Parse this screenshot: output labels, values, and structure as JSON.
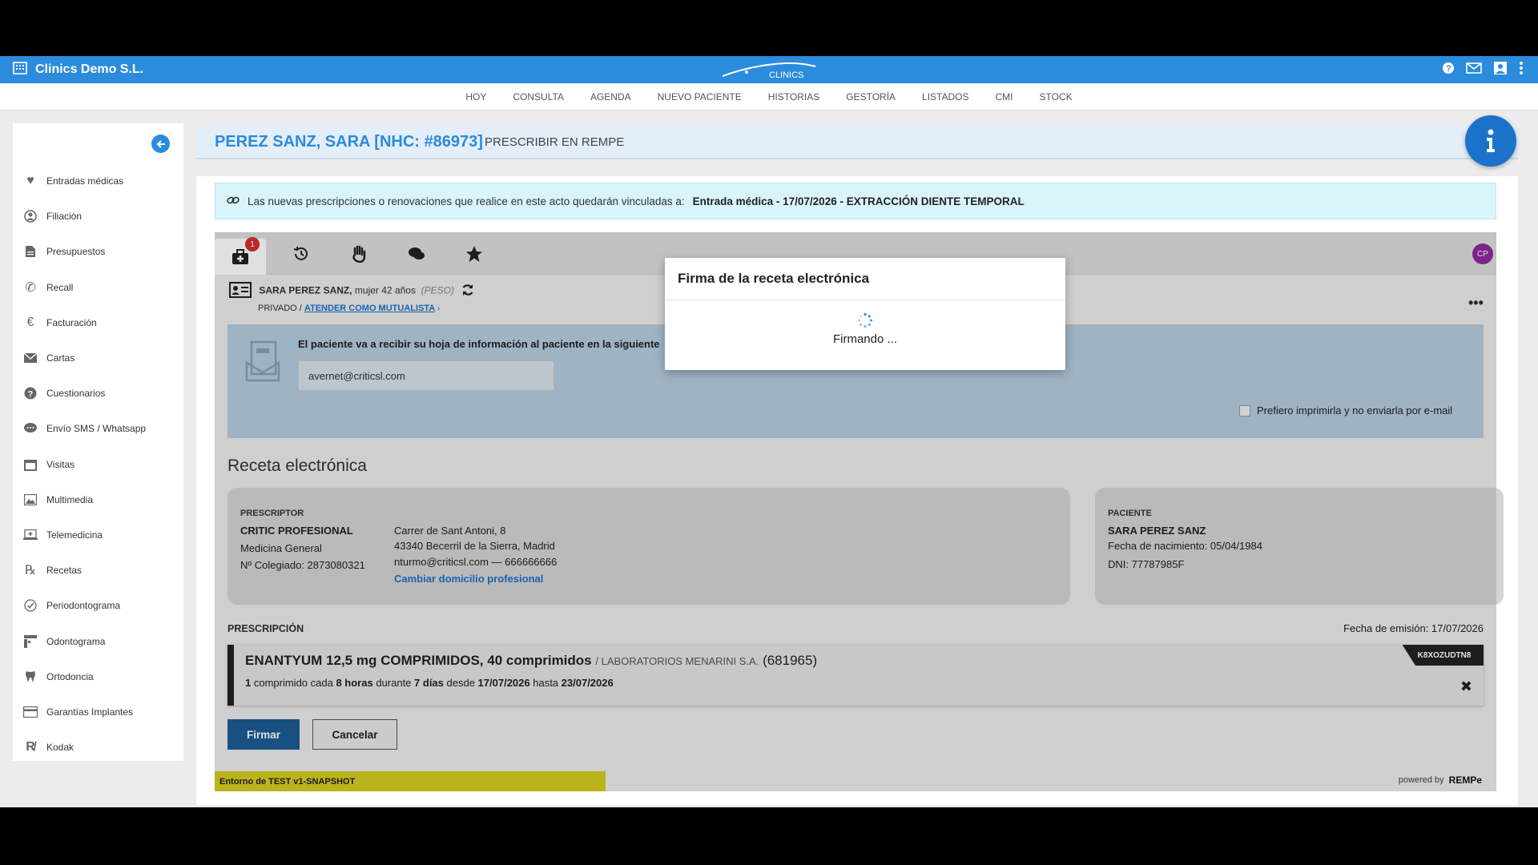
{
  "app": {
    "company": "Clinics Demo S.L.",
    "logo_text": "CLINICS"
  },
  "nav": [
    "HOY",
    "CONSULTA",
    "AGENDA",
    "NUEVO PACIENTE",
    "HISTORIAS",
    "GESTORÍA",
    "LISTADOS",
    "CMI",
    "STOCK"
  ],
  "sidebar": {
    "items": [
      {
        "label": "Entradas médicas",
        "icon": "heartbeat-icon"
      },
      {
        "label": "Filiación",
        "icon": "user-circle-icon"
      },
      {
        "label": "Presupuestos",
        "icon": "document-icon"
      },
      {
        "label": "Recall",
        "icon": "phone-icon"
      },
      {
        "label": "Facturación",
        "icon": "euro-icon"
      },
      {
        "label": "Cartas",
        "icon": "envelope-icon"
      },
      {
        "label": "Cuestionarios",
        "icon": "question-icon"
      },
      {
        "label": "Envío SMS / Whatsapp",
        "icon": "chat-icon"
      },
      {
        "label": "Visitas",
        "icon": "calendar-icon"
      },
      {
        "label": "Multimedia",
        "icon": "image-icon"
      },
      {
        "label": "Telemedicina",
        "icon": "laptop-plus-icon"
      },
      {
        "label": "Recetas",
        "icon": "prescription-icon"
      },
      {
        "label": "Periodontograma",
        "icon": "check-circle-icon"
      },
      {
        "label": "Odontograma",
        "icon": "odontogram-icon"
      },
      {
        "label": "Ortodoncia",
        "icon": "tooth-icon"
      },
      {
        "label": "Garantías Implantes",
        "icon": "card-icon"
      },
      {
        "label": "Kodak",
        "icon": "rx-icon"
      }
    ]
  },
  "header": {
    "patient_title": "PEREZ SANZ, SARA [NHC: #86973]",
    "subtitle": "PRESCRIBIR EN REMPE"
  },
  "notice": {
    "text": "Las nuevas prescripciones o renovaciones que realice en este acto quedarán vinculadas a:",
    "bold": "Entrada médica - 17/07/2026 - EXTRACCIÓN DIENTE TEMPORAL"
  },
  "tabs": {
    "badge": "1",
    "avatar": "CP"
  },
  "patient": {
    "name": "SARA PEREZ SANZ,",
    "details": "mujer 42 años",
    "weight": "(PESO)",
    "type": "PRIVADO /",
    "mutualista_link": "ATENDER COMO MUTUALISTA"
  },
  "email_section": {
    "text": "El paciente va a recibir su hoja de información al paciente en la siguiente",
    "email_value": "avernet@criticsl.com",
    "print_label": "Prefiero imprimirla y no enviarla por e-mail"
  },
  "receta": {
    "title": "Receta electrónica",
    "prescriptor": {
      "label": "PRESCRIPTOR",
      "name": "CRITIC PROFESIONAL",
      "specialty": "Medicina General",
      "colegiado": "Nº Colegiado: 2873080321",
      "address1": "Carrer de Sant Antoni, 8",
      "address2": "43340 Becerril de la Sierra, Madrid",
      "contact": "nturmo@criticsl.com — 666666666",
      "change_link": "Cambiar domicilio profesional"
    },
    "paciente": {
      "label": "PACIENTE",
      "name": "SARA PEREZ SANZ",
      "dob": "Fecha de nacimiento: 05/04/1984",
      "dni": "DNI: 77787985F"
    }
  },
  "prescripcion": {
    "label": "PRESCRIPCIÓN",
    "fecha": "Fecha de emisión: 17/07/2026",
    "med_name": "ENANTYUM 12,5 mg COMPRIMIDOS, 40 comprimidos",
    "lab": "/ LABORATORIOS MENARINI S.A.",
    "med_code": "(681965)",
    "dose_1": "1",
    "dose_2": " comprimido cada ",
    "dose_3": "8 horas",
    "dose_4": " durante ",
    "dose_5": "7 días",
    "dose_6": " desde ",
    "dose_7": "17/07/2026",
    "dose_8": " hasta ",
    "dose_9": "23/07/2026",
    "code_tag": "K8XOZUDTN8"
  },
  "buttons": {
    "firmar": "Firmar",
    "cancelar": "Cancelar"
  },
  "footer": {
    "env": "Entorno de TEST v1-SNAPSHOT",
    "powered": "powered by",
    "brand": "REMPe"
  },
  "modal": {
    "title": "Firma de la receta electrónica",
    "message": "Firmando ..."
  },
  "colors": {
    "brand_blue": "#2b8bdc",
    "firmar_blue": "#1c5c94",
    "env_yellow": "#d5cc1f"
  }
}
